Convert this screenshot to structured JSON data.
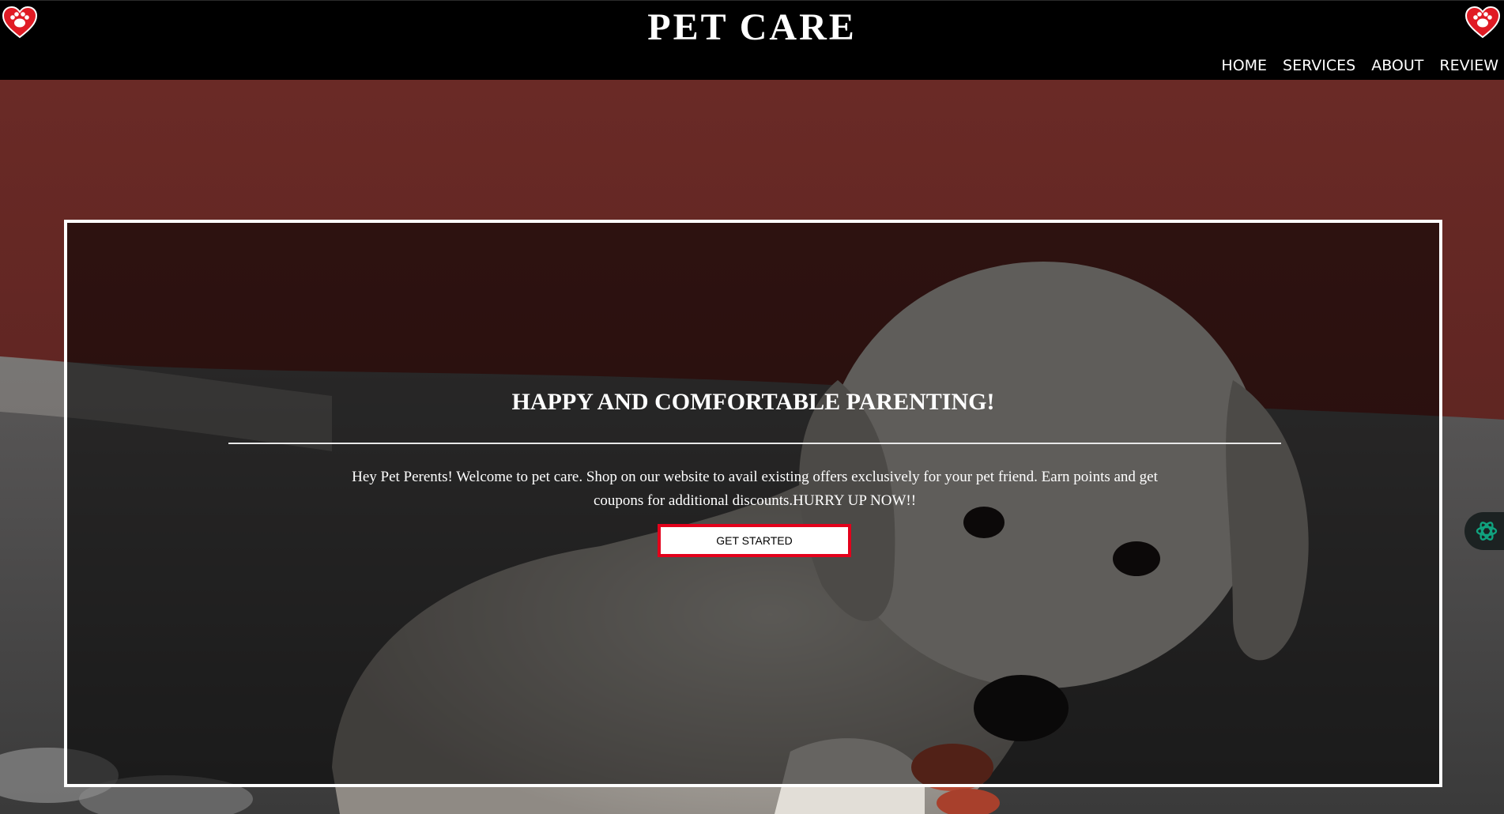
{
  "header": {
    "title": "PET CARE",
    "logo_icon": "heart-paw-icon",
    "nav": [
      {
        "label": "HOME"
      },
      {
        "label": "SERVICES"
      },
      {
        "label": "ABOUT"
      },
      {
        "label": "REVIEW"
      }
    ]
  },
  "hero": {
    "heading": "HAPPY AND COMFORTABLE PARENTING!",
    "body": "Hey Pet Perents! Welcome to pet care. Shop on our website to avail existing offers exclusively for your pet friend. Earn points and get coupons for additional discounts.HURRY UP NOW!!",
    "cta_label": "GET STARTED",
    "background_image": "puppy-eating-photo"
  },
  "side_widget": {
    "icon": "ai-assistant-icon"
  },
  "colors": {
    "header_bg": "#000000",
    "cta_border": "#e3001b",
    "logo_red": "#e01b24",
    "widget_accent": "#10a37f"
  }
}
